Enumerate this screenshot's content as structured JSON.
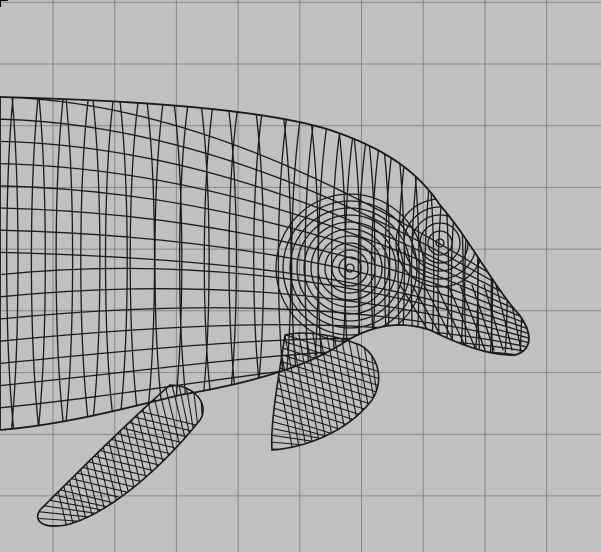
{
  "viewport": {
    "background": "#c0c0c0",
    "grid_color": "#888888",
    "wire_color": "#1a1a1a",
    "model": "dolphin-wireframe"
  }
}
